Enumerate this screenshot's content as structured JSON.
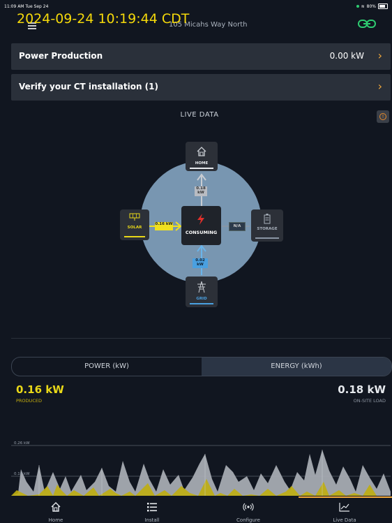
{
  "status_bar": {
    "time": "11:09 AM  Tue Sep 24",
    "battery": "80%"
  },
  "overlay_timestamp": "2024-09-24 10:19:44 CDT",
  "header": {
    "address": "105 Micahs Way North"
  },
  "rows": {
    "power_production": {
      "label": "Power Production",
      "value": "0.00 kW"
    },
    "verify_ct": {
      "label": "Verify your CT installation (1)"
    }
  },
  "live_data": {
    "title": "LIVE DATA",
    "nodes": {
      "home": "HOME",
      "solar": "SOLAR",
      "storage": "STORAGE",
      "grid": "GRID",
      "center": "CONSUMING"
    },
    "flows": {
      "home": "0.18 kW",
      "solar": "0.16 kW",
      "grid": "0.02 kW",
      "storage": "N/A"
    }
  },
  "toggle": {
    "power": "POWER (kW)",
    "energy": "ENERGY (kWh)"
  },
  "summary": {
    "produced_value": "0.16 kW",
    "produced_label": "PRODUCED",
    "load_value": "0.18 kW",
    "load_label": "ON-SITE LOAD"
  },
  "chart": {
    "y_top": "0.26 kW",
    "y_bottom": "0.18 kW"
  },
  "tabs": [
    {
      "label": "Home",
      "icon": "home-icon"
    },
    {
      "label": "Install",
      "icon": "list-icon"
    },
    {
      "label": "Configure",
      "icon": "broadcast-icon"
    },
    {
      "label": "Live Data",
      "icon": "chart-icon"
    }
  ],
  "colors": {
    "accent": "#f3a93b",
    "solar": "#e9d818",
    "grid": "#4aa0e0",
    "link": "#2ecc71"
  }
}
